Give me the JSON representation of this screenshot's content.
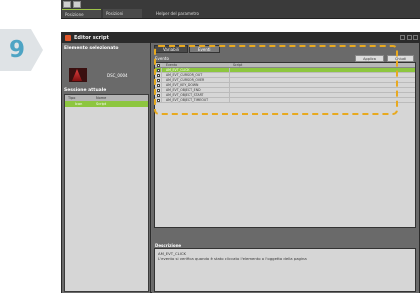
{
  "step_badge": {
    "number": "9"
  },
  "top_strip": {
    "tab_1": "Posizione",
    "tab_2": "Posizioni",
    "help_text": "Helper del parametro"
  },
  "window": {
    "title": "Editor script",
    "left_panel": {
      "selected_heading": "Elemento selezionato",
      "selected_name": "DSC_0004",
      "session_heading": "Sessione attuale",
      "session_columns": [
        "Tipo",
        "Nome"
      ],
      "session_rows": [
        {
          "type": "Icon",
          "name": "Script"
        }
      ]
    },
    "right_panel": {
      "tabs": [
        "Variabili",
        "Eventi"
      ],
      "active_tab": "Eventi",
      "events_label": "Evento",
      "buttons": {
        "apply": "Applica",
        "close": "Chiudi"
      },
      "grid_columns": [
        "Evento",
        "Script"
      ],
      "events": [
        "AM_EVT_CLICK",
        "AM_EVT_CURSOR_OUT",
        "AM_EVT_CURSOR_OVER",
        "AM_EVT_KEY_DOWN",
        "AM_EVT_OBJECT_END",
        "AM_EVT_OBJECT_START",
        "AM_EVT_OBJECT_TIMEOUT"
      ],
      "selected_event_index": 0,
      "description_label": "Descrizione",
      "description_title": "AM_EVT_CLICK",
      "description_text": "L'evento si verifica quando è stato cliccato l'elemento o l'oggetto della pagina"
    }
  },
  "colors": {
    "accent": "#8dc63f",
    "highlight": "#e8a91e",
    "badge_number": "#4ea4c4"
  }
}
